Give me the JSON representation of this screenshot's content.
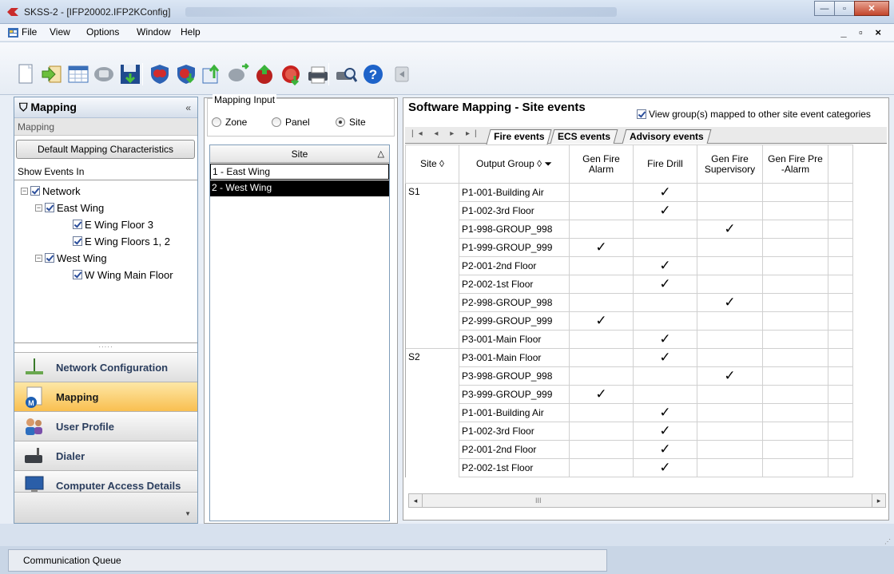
{
  "window": {
    "title": "SKSS-2 - [IFP20002.IFP2KConfig]"
  },
  "menu": {
    "items": [
      {
        "label": "File",
        "ul": "F"
      },
      {
        "label": "View",
        "ul": ""
      },
      {
        "label": "Options",
        "ul": ""
      },
      {
        "label": "Window",
        "ul": "W"
      },
      {
        "label": "Help",
        "ul": "H"
      }
    ],
    "mdi_controls": "_ ▫ ×"
  },
  "toolbar": {
    "icons": [
      "new-document-icon",
      "import-arrow-icon",
      "calendar-grid-icon",
      "phone-icon",
      "save-disk-icon",
      "shield-heart-icon",
      "shield-download-icon",
      "export-upload-icon",
      "phone-transfer-icon",
      "green-up-arrow-icon",
      "red-download-icon",
      "printer-icon",
      "print-preview-icon",
      "help-icon",
      "back-icon"
    ]
  },
  "left_panel": {
    "header": "Mapping",
    "subheader": "Mapping",
    "default_button": "Default Mapping Characteristics",
    "show_events_in": "Show Events In",
    "tree": [
      {
        "label": "Network",
        "level": 0,
        "expander": "−",
        "checked": true
      },
      {
        "label": "East Wing",
        "level": 1,
        "expander": "−",
        "checked": true
      },
      {
        "label": "E Wing Floor 3",
        "level": 2,
        "expander": "",
        "checked": true
      },
      {
        "label": "E Wing Floors 1, 2",
        "level": 2,
        "expander": "",
        "checked": true
      },
      {
        "label": "West Wing",
        "level": 1,
        "expander": "−",
        "checked": true
      },
      {
        "label": "W Wing Main Floor",
        "level": 2,
        "expander": "",
        "checked": true
      }
    ],
    "grip": "·····",
    "nav": [
      {
        "label": "Network Configuration",
        "icon": "network-config-icon",
        "selected": false
      },
      {
        "label": "Mapping",
        "icon": "mapping-icon",
        "selected": true
      },
      {
        "label": "User Profile",
        "icon": "user-profile-icon",
        "selected": false
      },
      {
        "label": "Dialer",
        "icon": "dialer-icon",
        "selected": false
      },
      {
        "label": "Computer Access Details",
        "icon": "computer-access-icon",
        "selected": false
      }
    ]
  },
  "mapping_input": {
    "legend": "Mapping Input",
    "options": [
      "Zone",
      "Panel",
      "Site"
    ],
    "selected": "Site",
    "list_header": "Site",
    "sort_glyph": "△",
    "sites": [
      "1 - East Wing",
      "2 - West Wing"
    ]
  },
  "right_panel": {
    "title": "Software Mapping - Site events",
    "view_groups_label": "View group(s) mapped to other site event categories",
    "view_groups_checked": true,
    "tab_nav": "|◂ ◂ ▸ ▸|",
    "tabs": [
      "Fire events",
      "ECS events",
      "Advisory events"
    ],
    "active_tab": "Fire events",
    "columns": [
      "Site ◊",
      "Output Group ◊ ⏷",
      "Gen Fire Alarm",
      "Fire Drill",
      "Gen Fire Supervisory",
      "Gen Fire Pre -Alarm",
      ""
    ],
    "check_glyph": "✓",
    "rows": [
      {
        "site": "S1",
        "group": "P1-001-Building Air",
        "marks": [
          false,
          true,
          false,
          false
        ]
      },
      {
        "site": "",
        "group": "P1-002-3rd Floor",
        "marks": [
          false,
          true,
          false,
          false
        ]
      },
      {
        "site": "",
        "group": "P1-998-GROUP_998",
        "marks": [
          false,
          false,
          true,
          false
        ]
      },
      {
        "site": "",
        "group": "P1-999-GROUP_999",
        "marks": [
          true,
          false,
          false,
          false
        ]
      },
      {
        "site": "",
        "group": "P2-001-2nd Floor",
        "marks": [
          false,
          true,
          false,
          false
        ]
      },
      {
        "site": "",
        "group": "P2-002-1st Floor",
        "marks": [
          false,
          true,
          false,
          false
        ]
      },
      {
        "site": "",
        "group": "P2-998-GROUP_998",
        "marks": [
          false,
          false,
          true,
          false
        ]
      },
      {
        "site": "",
        "group": "P2-999-GROUP_999",
        "marks": [
          true,
          false,
          false,
          false
        ]
      },
      {
        "site": "",
        "group": "P3-001-Main Floor",
        "marks": [
          false,
          true,
          false,
          false
        ]
      },
      {
        "site": "S2",
        "group": "P3-001-Main Floor",
        "marks": [
          false,
          true,
          false,
          false
        ]
      },
      {
        "site": "",
        "group": "P3-998-GROUP_998",
        "marks": [
          false,
          false,
          true,
          false
        ]
      },
      {
        "site": "",
        "group": "P3-999-GROUP_999",
        "marks": [
          true,
          false,
          false,
          false
        ]
      },
      {
        "site": "",
        "group": "P1-001-Building Air",
        "marks": [
          false,
          true,
          false,
          false
        ]
      },
      {
        "site": "",
        "group": "P1-002-3rd Floor",
        "marks": [
          false,
          true,
          false,
          false
        ]
      },
      {
        "site": "",
        "group": "P2-001-2nd Floor",
        "marks": [
          false,
          true,
          false,
          false
        ]
      },
      {
        "site": "",
        "group": "P2-002-1st Floor",
        "marks": [
          false,
          true,
          false,
          false
        ]
      }
    ],
    "scroll_thumb": "III"
  },
  "status": {
    "communication_queue": "Communication Queue"
  }
}
